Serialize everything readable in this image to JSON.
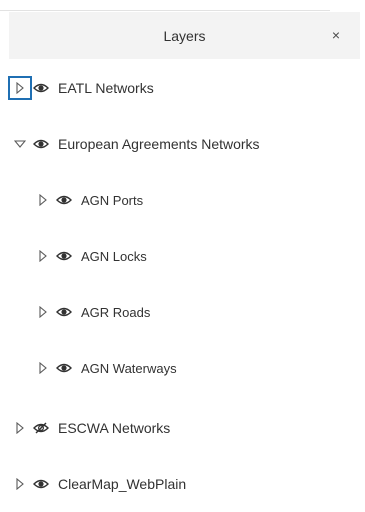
{
  "panel": {
    "title": "Layers",
    "close_icon": "close-icon",
    "close_symbol": "×"
  },
  "layers": [
    {
      "label": "EATL Networks",
      "expanded": false,
      "visible": true,
      "focused": true
    },
    {
      "label": "European Agreements Networks",
      "expanded": true,
      "visible": true,
      "children": [
        {
          "label": "AGN Ports",
          "expanded": false,
          "visible": true
        },
        {
          "label": "AGN Locks",
          "expanded": false,
          "visible": true
        },
        {
          "label": "AGR Roads",
          "expanded": false,
          "visible": true
        },
        {
          "label": "AGN Waterways",
          "expanded": false,
          "visible": true
        }
      ]
    },
    {
      "label": "ESCWA Networks",
      "expanded": false,
      "visible": false
    },
    {
      "label": "ClearMap_WebPlain",
      "expanded": false,
      "visible": true
    }
  ],
  "colors": {
    "header_bg": "#f3f3f3",
    "text": "#323232",
    "focus_outline": "#1f6fb3"
  }
}
